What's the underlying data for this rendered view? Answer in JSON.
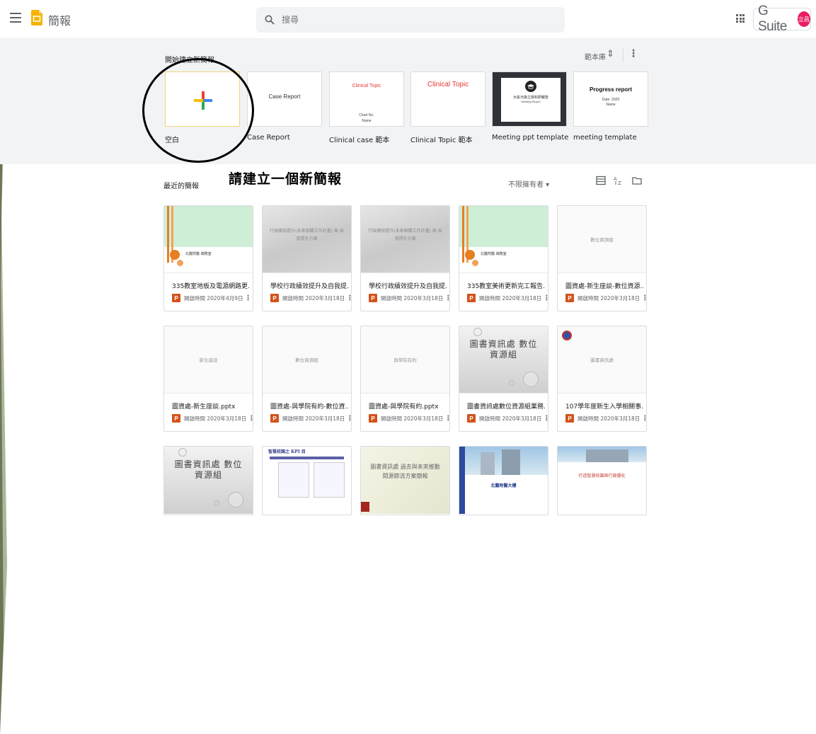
{
  "app": {
    "name": "簡報"
  },
  "search": {
    "placeholder": "搜尋"
  },
  "account": {
    "brand": "G Suite",
    "avatar_text": "立昌"
  },
  "gallery": {
    "title": "開始建立新簡報",
    "label": "範本庫",
    "templates": [
      {
        "name": "空白",
        "thumb": ""
      },
      {
        "name": "Case Report",
        "thumb": "Case Report"
      },
      {
        "name": "Clinical case 範本",
        "thumb": "Clinical Topic",
        "thumb_sub": "Chart No.",
        "thumb_sub2": "Name"
      },
      {
        "name": "Clinical Topic 範本",
        "thumb": "Clinical Topic"
      },
      {
        "name": "Meeting ppt template",
        "thumb": "大氣污染立体科研報告",
        "thumb_sub": "Meeting Report"
      },
      {
        "name": "meeting template",
        "thumb": "Progress report",
        "thumb_sub": "Date: 2020",
        "thumb_sub2": "Name"
      }
    ]
  },
  "annotation": {
    "text": "請建立一個新簡報"
  },
  "recent": {
    "label": "最近的簡報",
    "owner_filter": "不限擁有者 ▾",
    "files": [
      {
        "title": "335教室地板及電源網路更...",
        "date": "開啟時間 2020年4月9日",
        "thumb_text": "北醫附醫 總務室",
        "style": "green"
      },
      {
        "title": "學校行政績效提升及自我提...",
        "date": "開啟時間 2020年3月18日",
        "thumb_text": "行政績效提升(未來相關工作計畫) 與 自我提升方案",
        "style": "gray"
      },
      {
        "title": "學校行政績效提升及自我提...",
        "date": "開啟時間 2020年3月18日",
        "thumb_text": "行政績效提升(未來相關工作計畫) 與 自我提升方案",
        "style": "gray"
      },
      {
        "title": "335教室美術更新完工報告...",
        "date": "開啟時間 2020年3月18日",
        "thumb_text": "北醫附醫 總務室",
        "style": "green"
      },
      {
        "title": "圖資處-新生座談-數位資源...",
        "date": "開啟時間 2020年3月18日",
        "thumb_text": "數位資源組",
        "style": "white"
      },
      {
        "title": "圖資處-新生座談.pptx",
        "date": "開啟時間 2020年3月18日",
        "thumb_text": "新生座談",
        "style": "white"
      },
      {
        "title": "圖資處-與學院有約-數位資...",
        "date": "開啟時間 2020年3月18日",
        "thumb_text": "數位資源組",
        "style": "white"
      },
      {
        "title": "圖資處-與學院有約.pptx",
        "date": "開啟時間 2020年3月18日",
        "thumb_text": "與學院有約",
        "style": "white"
      },
      {
        "title": "圖書資訊處數位資源組業務...",
        "date": "開啟時間 2020年3月18日",
        "thumb_text": "圖書資訊處 數位資源組",
        "style": "bubble"
      },
      {
        "title": "107學年度新生入學相關事...",
        "date": "開啟時間 2020年3月18日",
        "thumb_text": "圖書資訊處",
        "style": "white"
      },
      {
        "title": "",
        "date": "",
        "thumb_text": "圖書資訊處 數位資源組",
        "style": "bubble"
      },
      {
        "title": "",
        "date": "",
        "thumb_text": "智慧校園之 KPI 目",
        "style": "doc"
      },
      {
        "title": "",
        "date": "",
        "thumb_text": "圖書資訊處 過去與未來推動 閱源節流方案簡報",
        "style": "cream"
      },
      {
        "title": "",
        "date": "",
        "thumb_text": "北醫附醫大樓",
        "style": "building"
      },
      {
        "title": "",
        "date": "",
        "thumb_text": "打造智慧校園與行政優化",
        "style": "building2"
      }
    ]
  },
  "colors": {
    "accent_orange": "#d2531c",
    "gallery_bg": "#f1f3f4",
    "avatar": "#e91e63"
  }
}
